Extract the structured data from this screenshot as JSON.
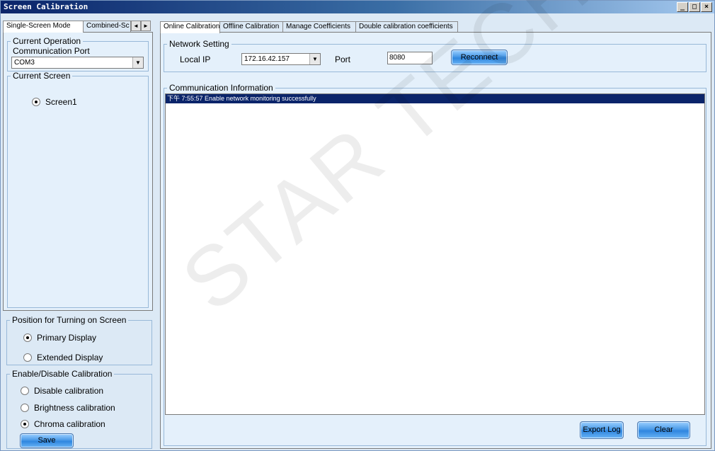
{
  "window": {
    "title": "Screen Calibration",
    "controls": [
      "_",
      "□",
      "×"
    ]
  },
  "left": {
    "tabs": [
      "Single-Screen Mode",
      "Combined-Sc"
    ],
    "tab_arrows": [
      "◄",
      "►"
    ],
    "operation_group": "Current Operation",
    "comm_port_label": "Communication Port",
    "comm_port_value": "COM3",
    "current_screen_group": "Current Screen",
    "screens": [
      {
        "label": "Screen1",
        "checked": true
      }
    ],
    "position_group": "Position for Turning on Screen",
    "position_options": [
      {
        "label": "Primary Display",
        "checked": true
      },
      {
        "label": "Extended Display",
        "checked": false
      }
    ],
    "calibration_group": "Enable/Disable Calibration",
    "calibration_options": [
      {
        "label": "Disable calibration",
        "checked": false
      },
      {
        "label": "Brightness calibration",
        "checked": false
      },
      {
        "label": "Chroma calibration",
        "checked": true
      }
    ],
    "save_label": "Save"
  },
  "right": {
    "tabs": [
      "Online Calibration",
      "Offline Calibration",
      "Manage Coefficients",
      "Double calibration coefficients"
    ],
    "network_group": "Network Setting",
    "local_ip_label": "Local IP",
    "local_ip_value": "172.16.42.157",
    "port_label": "Port",
    "port_value": "8080",
    "reconnect_label": "Reconnect",
    "comm_info_group": "Communication Information",
    "log": [
      "下午 7:55:57  Enable network monitoring successfully"
    ],
    "export_label": "Export Log",
    "clear_label": "Clear"
  },
  "watermark": "STAR TECH CO., LTD",
  "colors": {
    "title_start": "#0a246a",
    "panel_bg": "#e4f0fb",
    "selection": "#0a246a",
    "button_blue": "#2f86df"
  }
}
